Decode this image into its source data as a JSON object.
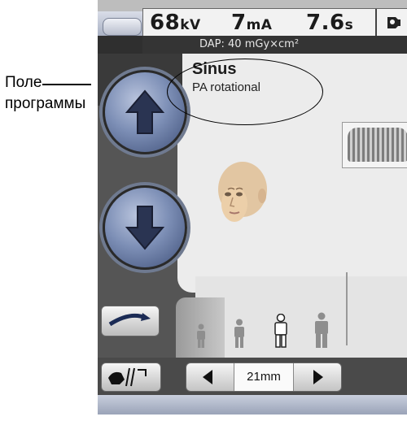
{
  "exposure": {
    "kv": "68",
    "kv_unit": "kV",
    "ma": "7",
    "ma_unit": "mA",
    "time": "7.6",
    "time_unit": "s"
  },
  "dap": {
    "label": "DAP: 40 mGy×cm²"
  },
  "program": {
    "title": "Sinus",
    "subtitle": "PA rotational"
  },
  "stepper": {
    "value": "21mm"
  },
  "callout": {
    "line1": "Поле",
    "line2": "программы"
  }
}
